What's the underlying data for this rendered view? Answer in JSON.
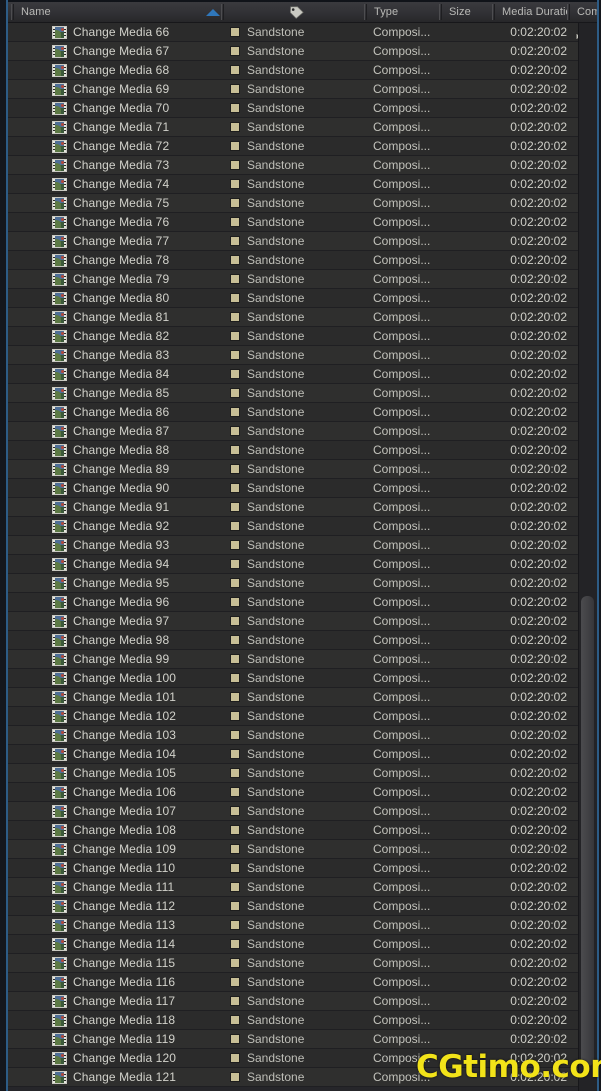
{
  "columns": [
    {
      "id": "name",
      "label": "Name",
      "sort": "ascending"
    },
    {
      "id": "label",
      "label": "",
      "icon": "tag-icon"
    },
    {
      "id": "type",
      "label": "Type"
    },
    {
      "id": "size",
      "label": "Size"
    },
    {
      "id": "duration",
      "label": "Media Duration"
    },
    {
      "id": "comment",
      "label": "Comm"
    }
  ],
  "colors": {
    "header_text": "#b9b9b6",
    "row_text": "#d2d2cb",
    "sort_arrow": "#2f77bb",
    "swatch_sandstone": "#c8bf96",
    "accent_border": "#2d5c86",
    "watermark": "#f2e319",
    "row_odd": "#2b2b2b",
    "row_even": "#2f2f2e"
  },
  "common": {
    "label_name": "Sandstone",
    "type": "Composi...",
    "size": "",
    "duration": "0:02:20:02",
    "comment_icon": "hierarchy-icon"
  },
  "rows": [
    {
      "name": "Change Media 66",
      "label": "Sandstone",
      "type": "Composi...",
      "size": "",
      "duration": "0:02:20:02",
      "has_hierarchy": true
    },
    {
      "name": "Change Media 67",
      "label": "Sandstone",
      "type": "Composi...",
      "size": "",
      "duration": "0:02:20:02",
      "has_hierarchy": false
    },
    {
      "name": "Change Media 68",
      "label": "Sandstone",
      "type": "Composi...",
      "size": "",
      "duration": "0:02:20:02",
      "has_hierarchy": false
    },
    {
      "name": "Change Media 69",
      "label": "Sandstone",
      "type": "Composi...",
      "size": "",
      "duration": "0:02:20:02",
      "has_hierarchy": false
    },
    {
      "name": "Change Media 70",
      "label": "Sandstone",
      "type": "Composi...",
      "size": "",
      "duration": "0:02:20:02",
      "has_hierarchy": false
    },
    {
      "name": "Change Media 71",
      "label": "Sandstone",
      "type": "Composi...",
      "size": "",
      "duration": "0:02:20:02",
      "has_hierarchy": false
    },
    {
      "name": "Change Media 72",
      "label": "Sandstone",
      "type": "Composi...",
      "size": "",
      "duration": "0:02:20:02",
      "has_hierarchy": false
    },
    {
      "name": "Change Media 73",
      "label": "Sandstone",
      "type": "Composi...",
      "size": "",
      "duration": "0:02:20:02",
      "has_hierarchy": false
    },
    {
      "name": "Change Media 74",
      "label": "Sandstone",
      "type": "Composi...",
      "size": "",
      "duration": "0:02:20:02",
      "has_hierarchy": false
    },
    {
      "name": "Change Media 75",
      "label": "Sandstone",
      "type": "Composi...",
      "size": "",
      "duration": "0:02:20:02",
      "has_hierarchy": false
    },
    {
      "name": "Change Media 76",
      "label": "Sandstone",
      "type": "Composi...",
      "size": "",
      "duration": "0:02:20:02",
      "has_hierarchy": false
    },
    {
      "name": "Change Media 77",
      "label": "Sandstone",
      "type": "Composi...",
      "size": "",
      "duration": "0:02:20:02",
      "has_hierarchy": false
    },
    {
      "name": "Change Media 78",
      "label": "Sandstone",
      "type": "Composi...",
      "size": "",
      "duration": "0:02:20:02",
      "has_hierarchy": false
    },
    {
      "name": "Change Media 79",
      "label": "Sandstone",
      "type": "Composi...",
      "size": "",
      "duration": "0:02:20:02",
      "has_hierarchy": false
    },
    {
      "name": "Change Media 80",
      "label": "Sandstone",
      "type": "Composi...",
      "size": "",
      "duration": "0:02:20:02",
      "has_hierarchy": false
    },
    {
      "name": "Change Media 81",
      "label": "Sandstone",
      "type": "Composi...",
      "size": "",
      "duration": "0:02:20:02",
      "has_hierarchy": false
    },
    {
      "name": "Change Media 82",
      "label": "Sandstone",
      "type": "Composi...",
      "size": "",
      "duration": "0:02:20:02",
      "has_hierarchy": false
    },
    {
      "name": "Change Media 83",
      "label": "Sandstone",
      "type": "Composi...",
      "size": "",
      "duration": "0:02:20:02",
      "has_hierarchy": false
    },
    {
      "name": "Change Media 84",
      "label": "Sandstone",
      "type": "Composi...",
      "size": "",
      "duration": "0:02:20:02",
      "has_hierarchy": false
    },
    {
      "name": "Change Media 85",
      "label": "Sandstone",
      "type": "Composi...",
      "size": "",
      "duration": "0:02:20:02",
      "has_hierarchy": false
    },
    {
      "name": "Change Media 86",
      "label": "Sandstone",
      "type": "Composi...",
      "size": "",
      "duration": "0:02:20:02",
      "has_hierarchy": false
    },
    {
      "name": "Change Media 87",
      "label": "Sandstone",
      "type": "Composi...",
      "size": "",
      "duration": "0:02:20:02",
      "has_hierarchy": false
    },
    {
      "name": "Change Media 88",
      "label": "Sandstone",
      "type": "Composi...",
      "size": "",
      "duration": "0:02:20:02",
      "has_hierarchy": false
    },
    {
      "name": "Change Media 89",
      "label": "Sandstone",
      "type": "Composi...",
      "size": "",
      "duration": "0:02:20:02",
      "has_hierarchy": false
    },
    {
      "name": "Change Media 90",
      "label": "Sandstone",
      "type": "Composi...",
      "size": "",
      "duration": "0:02:20:02",
      "has_hierarchy": false
    },
    {
      "name": "Change Media 91",
      "label": "Sandstone",
      "type": "Composi...",
      "size": "",
      "duration": "0:02:20:02",
      "has_hierarchy": false
    },
    {
      "name": "Change Media 92",
      "label": "Sandstone",
      "type": "Composi...",
      "size": "",
      "duration": "0:02:20:02",
      "has_hierarchy": false
    },
    {
      "name": "Change Media 93",
      "label": "Sandstone",
      "type": "Composi...",
      "size": "",
      "duration": "0:02:20:02",
      "has_hierarchy": false
    },
    {
      "name": "Change Media 94",
      "label": "Sandstone",
      "type": "Composi...",
      "size": "",
      "duration": "0:02:20:02",
      "has_hierarchy": false
    },
    {
      "name": "Change Media 95",
      "label": "Sandstone",
      "type": "Composi...",
      "size": "",
      "duration": "0:02:20:02",
      "has_hierarchy": false
    },
    {
      "name": "Change Media 96",
      "label": "Sandstone",
      "type": "Composi...",
      "size": "",
      "duration": "0:02:20:02",
      "has_hierarchy": false
    },
    {
      "name": "Change Media 97",
      "label": "Sandstone",
      "type": "Composi...",
      "size": "",
      "duration": "0:02:20:02",
      "has_hierarchy": false
    },
    {
      "name": "Change Media 98",
      "label": "Sandstone",
      "type": "Composi...",
      "size": "",
      "duration": "0:02:20:02",
      "has_hierarchy": false
    },
    {
      "name": "Change Media 99",
      "label": "Sandstone",
      "type": "Composi...",
      "size": "",
      "duration": "0:02:20:02",
      "has_hierarchy": false
    },
    {
      "name": "Change Media 100",
      "label": "Sandstone",
      "type": "Composi...",
      "size": "",
      "duration": "0:02:20:02",
      "has_hierarchy": false
    },
    {
      "name": "Change Media 101",
      "label": "Sandstone",
      "type": "Composi...",
      "size": "",
      "duration": "0:02:20:02",
      "has_hierarchy": false
    },
    {
      "name": "Change Media 102",
      "label": "Sandstone",
      "type": "Composi...",
      "size": "",
      "duration": "0:02:20:02",
      "has_hierarchy": false
    },
    {
      "name": "Change Media 103",
      "label": "Sandstone",
      "type": "Composi...",
      "size": "",
      "duration": "0:02:20:02",
      "has_hierarchy": false
    },
    {
      "name": "Change Media 104",
      "label": "Sandstone",
      "type": "Composi...",
      "size": "",
      "duration": "0:02:20:02",
      "has_hierarchy": false
    },
    {
      "name": "Change Media 105",
      "label": "Sandstone",
      "type": "Composi...",
      "size": "",
      "duration": "0:02:20:02",
      "has_hierarchy": false
    },
    {
      "name": "Change Media 106",
      "label": "Sandstone",
      "type": "Composi...",
      "size": "",
      "duration": "0:02:20:02",
      "has_hierarchy": false
    },
    {
      "name": "Change Media 107",
      "label": "Sandstone",
      "type": "Composi...",
      "size": "",
      "duration": "0:02:20:02",
      "has_hierarchy": false
    },
    {
      "name": "Change Media 108",
      "label": "Sandstone",
      "type": "Composi...",
      "size": "",
      "duration": "0:02:20:02",
      "has_hierarchy": false
    },
    {
      "name": "Change Media 109",
      "label": "Sandstone",
      "type": "Composi...",
      "size": "",
      "duration": "0:02:20:02",
      "has_hierarchy": false
    },
    {
      "name": "Change Media 110",
      "label": "Sandstone",
      "type": "Composi...",
      "size": "",
      "duration": "0:02:20:02",
      "has_hierarchy": false
    },
    {
      "name": "Change Media 111",
      "label": "Sandstone",
      "type": "Composi...",
      "size": "",
      "duration": "0:02:20:02",
      "has_hierarchy": false
    },
    {
      "name": "Change Media 112",
      "label": "Sandstone",
      "type": "Composi...",
      "size": "",
      "duration": "0:02:20:02",
      "has_hierarchy": false
    },
    {
      "name": "Change Media 113",
      "label": "Sandstone",
      "type": "Composi...",
      "size": "",
      "duration": "0:02:20:02",
      "has_hierarchy": false
    },
    {
      "name": "Change Media 114",
      "label": "Sandstone",
      "type": "Composi...",
      "size": "",
      "duration": "0:02:20:02",
      "has_hierarchy": false
    },
    {
      "name": "Change Media 115",
      "label": "Sandstone",
      "type": "Composi...",
      "size": "",
      "duration": "0:02:20:02",
      "has_hierarchy": false
    },
    {
      "name": "Change Media 116",
      "label": "Sandstone",
      "type": "Composi...",
      "size": "",
      "duration": "0:02:20:02",
      "has_hierarchy": false
    },
    {
      "name": "Change Media 117",
      "label": "Sandstone",
      "type": "Composi...",
      "size": "",
      "duration": "0:02:20:02",
      "has_hierarchy": false
    },
    {
      "name": "Change Media 118",
      "label": "Sandstone",
      "type": "Composi...",
      "size": "",
      "duration": "0:02:20:02",
      "has_hierarchy": false
    },
    {
      "name": "Change Media 119",
      "label": "Sandstone",
      "type": "Composi...",
      "size": "",
      "duration": "0:02:20:02",
      "has_hierarchy": false
    },
    {
      "name": "Change Media 120",
      "label": "Sandstone",
      "type": "Composi...",
      "size": "",
      "duration": "0:02:20:02",
      "has_hierarchy": false
    },
    {
      "name": "Change Media 121",
      "label": "Sandstone",
      "type": "Composi...",
      "size": "",
      "duration": "0:02:20:02",
      "has_hierarchy": false
    }
  ],
  "watermark": {
    "text": "CGtimo.com"
  }
}
